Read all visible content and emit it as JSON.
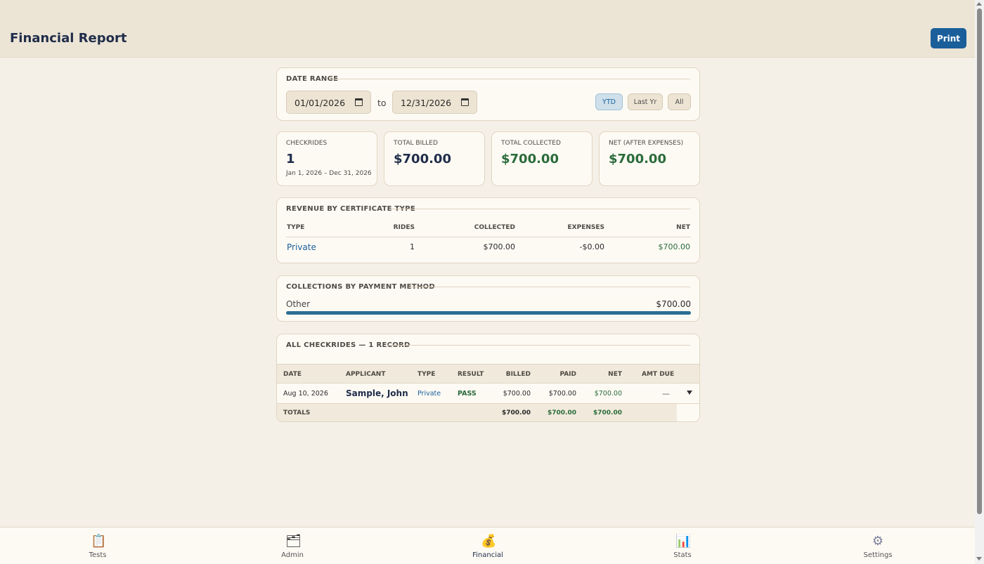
{
  "header": {
    "title": "Financial Report",
    "print_label": "Print"
  },
  "date_range": {
    "title": "DATE RANGE",
    "from": "01/01/2026",
    "to_label": "to",
    "to": "12/31/2026",
    "presets": [
      {
        "label": "YTD",
        "active": true
      },
      {
        "label": "Last Yr",
        "active": false
      },
      {
        "label": "All",
        "active": false
      }
    ]
  },
  "stats": [
    {
      "label": "CHECKRIDES",
      "value": "1",
      "sub": "Jan 1, 2026 – Dec 31, 2026"
    },
    {
      "label": "TOTAL BILLED",
      "value": "$700.00"
    },
    {
      "label": "TOTAL COLLECTED",
      "value": "$700.00"
    },
    {
      "label": "NET (AFTER EXPENSES)",
      "value": "$700.00"
    }
  ],
  "revenue": {
    "title": "REVENUE BY CERTIFICATE TYPE",
    "columns": [
      "TYPE",
      "RIDES",
      "COLLECTED",
      "EXPENSES",
      "NET"
    ],
    "rows": [
      {
        "type": "Private",
        "rides": "1",
        "collected": "$700.00",
        "expenses": "-$0.00",
        "net": "$700.00"
      }
    ]
  },
  "payments": {
    "title": "COLLECTIONS BY PAYMENT METHOD",
    "items": [
      {
        "method": "Other",
        "amount": "$700.00",
        "share": 1.0
      }
    ]
  },
  "records": {
    "title": "ALL CHECKRIDES — 1 RECORD",
    "columns": [
      "DATE",
      "APPLICANT",
      "TYPE",
      "RESULT",
      "BILLED",
      "PAID",
      "NET",
      "AMT DUE"
    ],
    "rows": [
      {
        "date": "Aug 10, 2026",
        "applicant": "Sample, John",
        "type": "Private",
        "result": "PASS",
        "billed": "$700.00",
        "paid": "$700.00",
        "net": "$700.00",
        "amt_due": "—"
      }
    ],
    "totals": {
      "label": "TOTALS",
      "billed": "$700.00",
      "paid": "$700.00",
      "net": "$700.00"
    }
  },
  "nav": [
    {
      "label": "Tests",
      "icon": "clipboard-icon",
      "glyph": "📋",
      "active": false
    },
    {
      "label": "Admin",
      "icon": "folder-icon",
      "glyph": "🗂",
      "active": false
    },
    {
      "label": "Financial",
      "icon": "money-bag-icon",
      "glyph": "💰",
      "active": true
    },
    {
      "label": "Stats",
      "icon": "bar-chart-icon",
      "glyph": "📊",
      "active": false
    },
    {
      "label": "Settings",
      "icon": "gear-icon",
      "glyph": "⚙",
      "active": false
    }
  ],
  "colors": {
    "accent": "#1a5f9a",
    "positive": "#2a6b3a",
    "header_bg": "#ece4d5",
    "page_bg": "#f5f0e7"
  }
}
